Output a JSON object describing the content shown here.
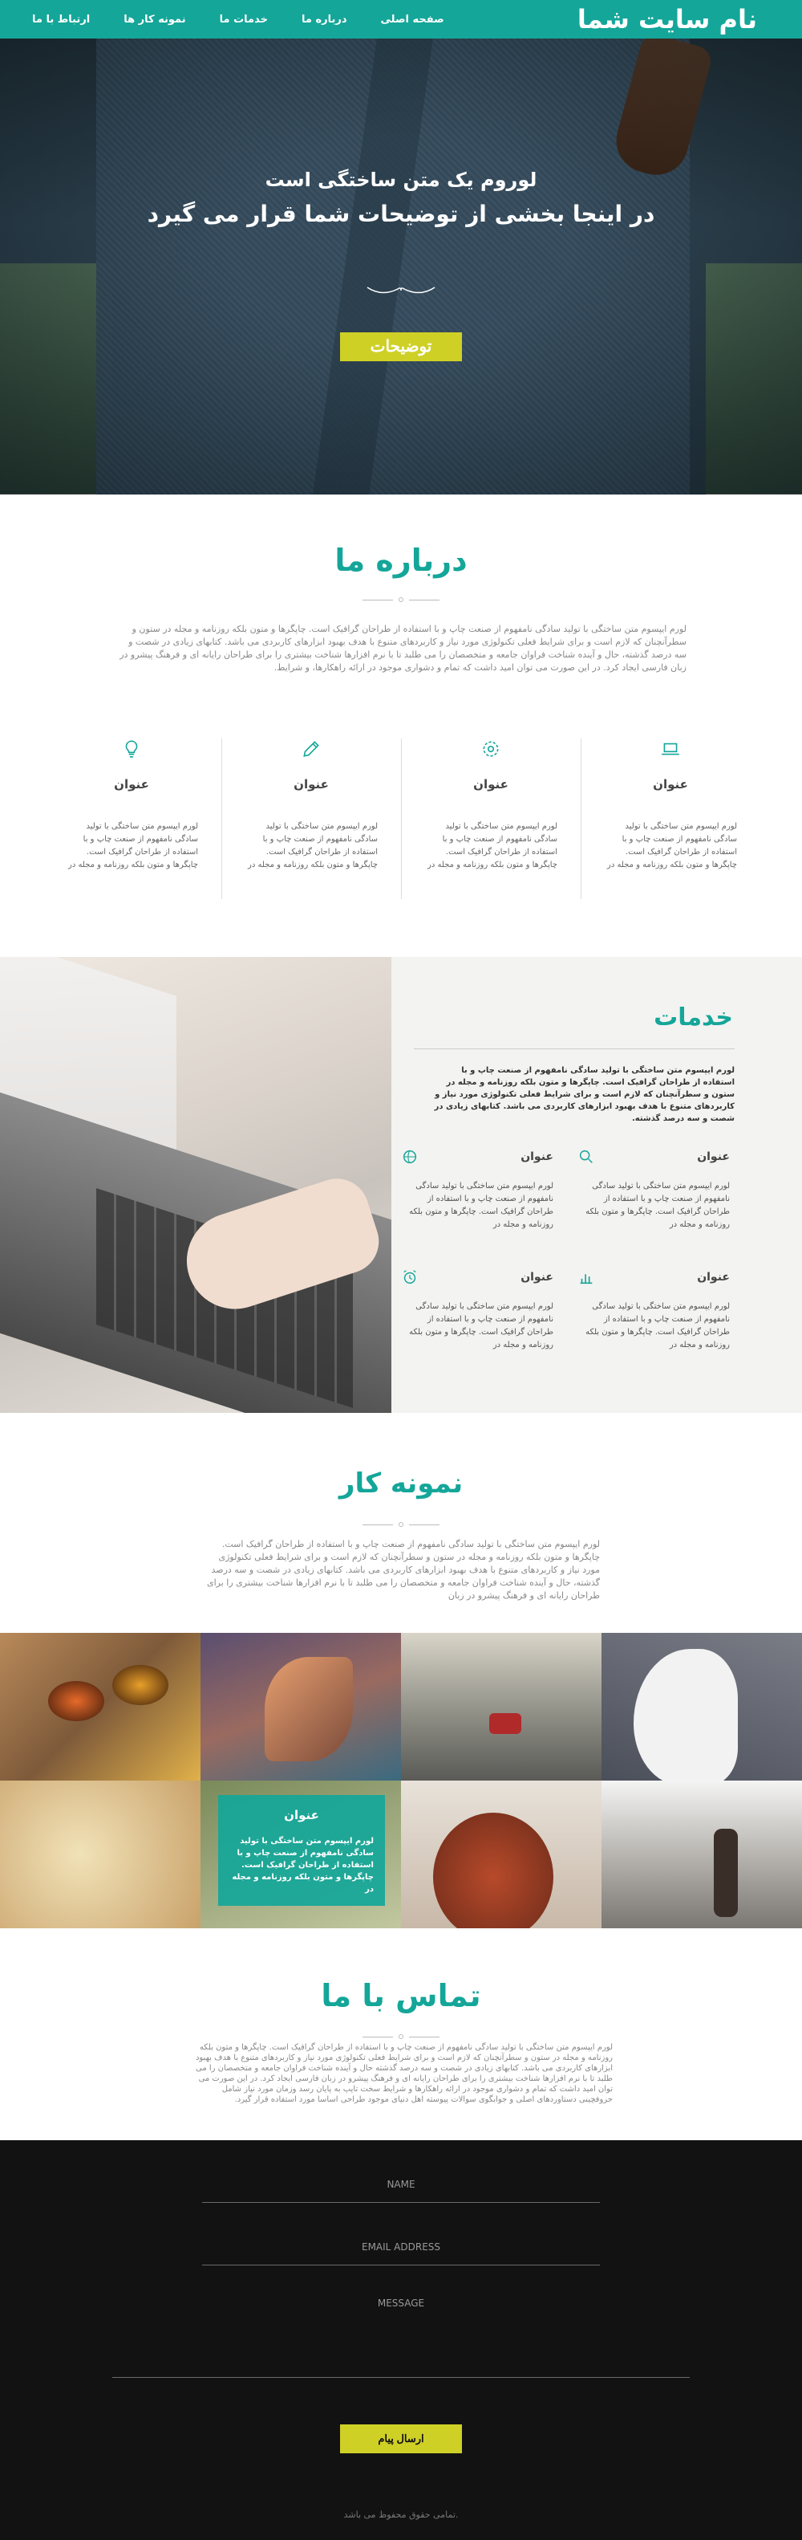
{
  "nav": {
    "brand": "نام سایت شما",
    "links": [
      "صفحه اصلی",
      "درباره ما",
      "خدمات ما",
      "نمونه کار ها",
      "ارتباط با ما"
    ]
  },
  "hero": {
    "line1": "لوروم یک متن ساختگی است",
    "line2": "در اینجا بخشی از توضیحات شما قرار می گیرد",
    "button": "توضیحات"
  },
  "about": {
    "title": "درباره ما",
    "paragraph": "لورم ایپسوم متن ساختگی با تولید سادگی نامفهوم از صنعت چاپ و با استفاده از طراحان گرافیک است. چاپگرها و متون بلکه روزنامه و مجله در ستون و سطرآنچنان که لازم است و برای شرایط فعلی تکنولوژی مورد نیاز و کاربردهای متنوع با هدف بهبود ابزارهای کاربردی می باشد. کتابهای زیادی در شصت و سه درصد گذشته، حال و آینده شناخت فراوان جامعه و متخصصان را می طلبد تا با نرم افزارها شناخت بیشتری را برای طراحان رایانه ای و فرهنگ پیشرو در زبان فارسی ایجاد کرد. در این صورت می توان امید داشت که تمام و دشواری موجود در ارائه راهکارها، و شرایط.",
    "features": [
      {
        "icon": "laptop-icon",
        "title": "عنوان",
        "text": "لورم ایپسوم متن ساختگی با تولید سادگی نامفهوم از صنعت چاپ و با استفاده از طراحان گرافیک است. چاپگرها و متون بلکه روزنامه و مجله در"
      },
      {
        "icon": "gear-icon",
        "title": "عنوان",
        "text": "لورم ایپسوم متن ساختگی با تولید سادگی نامفهوم از صنعت چاپ و با استفاده از طراحان گرافیک است. چاپگرها و متون بلکه روزنامه و مجله در"
      },
      {
        "icon": "pencil-icon",
        "title": "عنوان",
        "text": "لورم ایپسوم متن ساختگی با تولید سادگی نامفهوم از صنعت چاپ و با استفاده از طراحان گرافیک است. چاپگرها و متون بلکه روزنامه و مجله در"
      },
      {
        "icon": "lightbulb-icon",
        "title": "عنوان",
        "text": "لورم ایپسوم متن ساختگی با تولید سادگی نامفهوم از صنعت چاپ و با استفاده از طراحان گرافیک است. چاپگرها و متون بلکه روزنامه و مجله در"
      }
    ]
  },
  "services": {
    "title": "خدمات",
    "description": "لورم ایپسوم متن ساختگی با تولید سادگی نامفهوم از صنعت چاپ و با استفاده از طراحان گرافیک است. چاپگرها و متون بلکه روزنامه و مجله در ستون و سطرآنچنان که لازم است و برای شرایط فعلی تکنولوژی مورد نیاز و کاربردهای متنوع با هدف بهبود ابزارهای کاربردی می باشد. کتابهای زیادی در شصت و سه درصد گذشته.",
    "items": [
      {
        "icon": "search-icon",
        "title": "عنوان",
        "text": "لورم ایپسوم متن ساختگی با تولید سادگی نامفهوم از صنعت چاپ و با استفاده از طراحان گرافیک است. چاپگرها و متون بلکه روزنامه و مجله در"
      },
      {
        "icon": "globe-icon",
        "title": "عنوان",
        "text": "لورم ایپسوم متن ساختگی با تولید سادگی نامفهوم از صنعت چاپ و با استفاده از طراحان گرافیک است. چاپگرها و متون بلکه روزنامه و مجله در"
      },
      {
        "icon": "chart-icon",
        "title": "عنوان",
        "text": "لورم ایپسوم متن ساختگی با تولید سادگی نامفهوم از صنعت چاپ و با استفاده از طراحان گرافیک است. چاپگرها و متون بلکه روزنامه و مجله در"
      },
      {
        "icon": "alarm-clock-icon",
        "title": "عنوان",
        "text": "لورم ایپسوم متن ساختگی با تولید سادگی نامفهوم از صنعت چاپ و با استفاده از طراحان گرافیک است. چاپگرها و متون بلکه روزنامه و مجله در"
      }
    ]
  },
  "portfolio": {
    "title": "نمونه کار",
    "paragraph": "لورم ایپسوم متن ساختگی با تولید سادگی نامفهوم از صنعت چاپ و با استفاده از طراحان گرافیک است. چاپگرها و متون بلکه روزنامه و مجله در ستون و سطرآنچنان که لازم است و برای شرایط فعلی تکنولوژی مورد نیاز و کاربردهای متنوع با هدف بهبود ابزارهای کاربردی می باشد. کتابهای زیادی در شصت و سه درصد گذشته، حال و آینده شناخت فراوان جامعه و متخصصان را می طلبد تا با نرم افزارها شناخت بیشتری را برای طراحان رایانه ای و فرهنگ پیشرو در زبان",
    "overlay_title": "عنوان",
    "overlay_text": "لورم ایپسوم متن ساختگی با تولید سادگی نامفهوم از صنعت چاپ و با استفاده از طراحان گرافیک است. چاپگرها و متون بلکه روزنامه و مجله در"
  },
  "contact": {
    "title": "تماس با ما",
    "paragraph": "لورم ایپسوم متن ساختگی با تولید سادگی نامفهوم از صنعت چاپ و با استفاده از طراحان گرافیک است. چاپگرها و متون بلکه روزنامه و مجله در ستون و سطرآنچنان که لازم است و برای شرایط فعلی تکنولوژی مورد نیاز و کاربردهای متنوع با هدف بهبود ابزارهای کاربردی می باشد. کتابهای زیادی در شصت و سه درصد گذشته حال و آینده شناخت فراوان جامعه و متخصصان را می طلبد تا با نرم افزارها شناخت بیشتری را برای طراحان رایانه ای و فرهنگ پیشرو در زبان فارسی ایجاد کرد. در این صورت می توان امید داشت که تمام و دشواری موجود در ارائه راهکارها و شرایط سخت تایپ به پایان رسد وزمان مورد نیاز شامل حروفچینی دستاوردهای اصلی و جوابگوی سوالات پیوسته اهل دنیای موجود طراحی اساسا مورد استفاده قرار گیرد.",
    "name_placeholder": "NAME",
    "email_placeholder": "EMAIL ADDRESS",
    "message_placeholder": "MESSAGE",
    "send_button": "ارسال پیام"
  },
  "footer": {
    "copyright": "تمامی حقوق محفوظ می باشد."
  },
  "colors": {
    "accent": "#14a699",
    "button": "#cfd026",
    "dark": "#121212"
  }
}
